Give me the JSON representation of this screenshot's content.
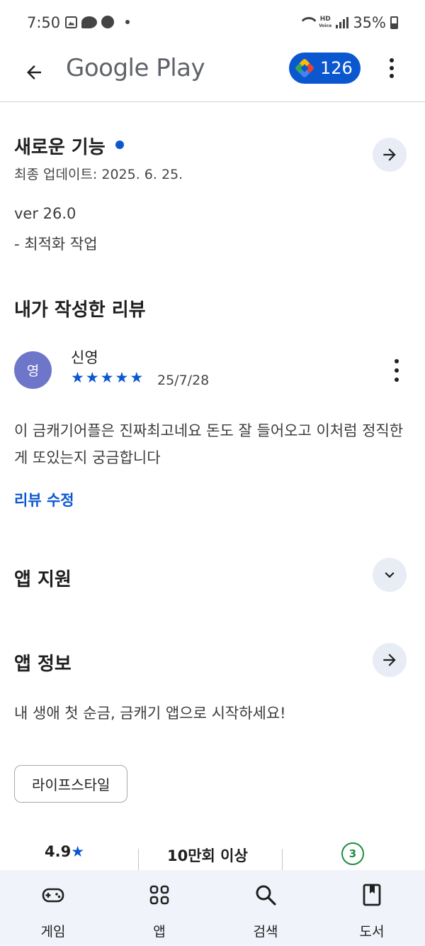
{
  "status_bar": {
    "time": "7:50",
    "battery": "35%",
    "hd_label_1": "HD",
    "hd_label_2": "Voice",
    "icons": [
      "gallery-icon",
      "chat-bubble-icon",
      "ball-icon",
      "dot-icon",
      "wifi-icon",
      "signal-icon",
      "battery-icon"
    ]
  },
  "app_bar": {
    "title": "Google Play",
    "points": "126",
    "icons": [
      "back-arrow-icon",
      "play-points-icon",
      "more-vert-icon"
    ]
  },
  "whats_new": {
    "title": "새로운 기능",
    "updated": "최종 업데이트: 2025. 6. 25.",
    "version": "ver 26.0",
    "note": "- 최적화 작업"
  },
  "my_review": {
    "title": "내가 작성한 리뷰",
    "avatar_initial": "영",
    "reviewer": "신영",
    "rating": 5,
    "date": "25/7/28",
    "text": "이 금캐기어플은 진짜최고네요 돈도 잘 들어오고 이처럼 정직한게 또있는지 궁금합니다",
    "edit_label": "리뷰 수정"
  },
  "app_support": {
    "title": "앱 지원"
  },
  "app_info": {
    "title": "앱 정보",
    "description": "내 생애 첫 순금, 금캐기 앱으로 시작하세요!",
    "category_chip": "라이프스타일"
  },
  "stats": {
    "rating": "4.9",
    "rating_star": "★",
    "downloads": "10만회 이상",
    "age_rating": "3"
  },
  "bottom_nav": {
    "items": [
      {
        "label": "게임",
        "icon": "gamepad-icon"
      },
      {
        "label": "앱",
        "icon": "apps-grid-icon"
      },
      {
        "label": "검색",
        "icon": "search-icon"
      },
      {
        "label": "도서",
        "icon": "book-icon"
      }
    ]
  },
  "colors": {
    "accent": "#0b57d0",
    "avatar": "#6e76c9",
    "age_badge": "#1e8e3e",
    "nav_bg": "#f0f3f9"
  }
}
